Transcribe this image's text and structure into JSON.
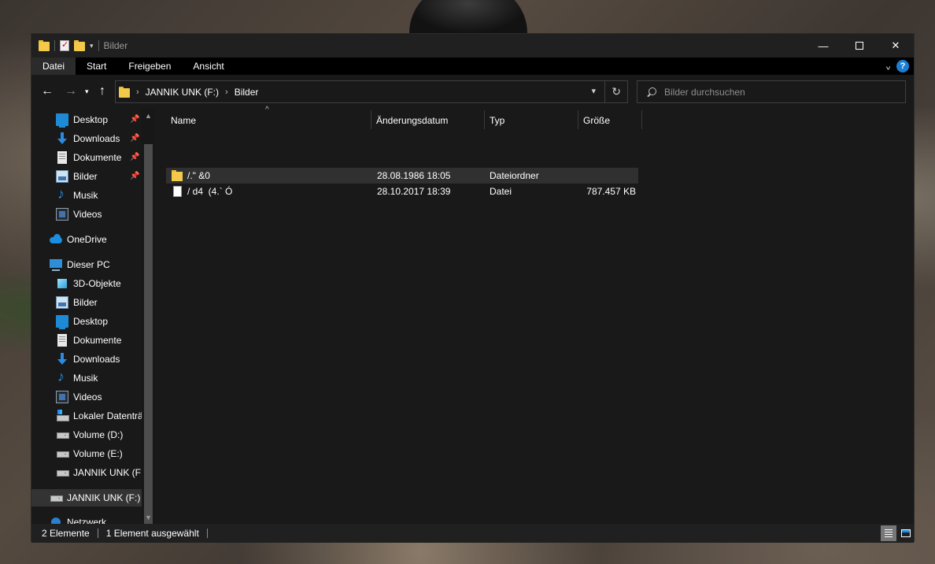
{
  "window": {
    "title": "Bilder",
    "controls": {
      "minimize": "—",
      "maximize": "",
      "close": "✕"
    }
  },
  "ribbon": {
    "tabs": [
      "Datei",
      "Start",
      "Freigeben",
      "Ansicht"
    ],
    "active_tab": "Datei"
  },
  "address": {
    "crumbs": [
      "JANNIK UNK (F:)",
      "Bilder"
    ]
  },
  "search": {
    "placeholder": "Bilder durchsuchen"
  },
  "sidebar": {
    "quick_access": [
      {
        "label": "Desktop",
        "icon": "desktop-icon",
        "pinned": true
      },
      {
        "label": "Downloads",
        "icon": "downloads-icon",
        "pinned": true
      },
      {
        "label": "Dokumente",
        "icon": "documents-icon",
        "pinned": true
      },
      {
        "label": "Bilder",
        "icon": "pictures-icon",
        "pinned": true
      },
      {
        "label": "Musik",
        "icon": "music-icon",
        "pinned": false
      },
      {
        "label": "Videos",
        "icon": "videos-icon",
        "pinned": false
      }
    ],
    "onedrive": "OneDrive",
    "this_pc": "Dieser PC",
    "pc_items": [
      {
        "label": "3D-Objekte",
        "icon": "3d-objects-icon"
      },
      {
        "label": "Bilder",
        "icon": "pictures-icon"
      },
      {
        "label": "Desktop",
        "icon": "desktop-icon"
      },
      {
        "label": "Dokumente",
        "icon": "documents-icon"
      },
      {
        "label": "Downloads",
        "icon": "downloads-icon"
      },
      {
        "label": "Musik",
        "icon": "music-icon"
      },
      {
        "label": "Videos",
        "icon": "videos-icon"
      },
      {
        "label": "Lokaler Datenträger (C:)",
        "icon": "system-drive-icon"
      },
      {
        "label": "Volume (D:)",
        "icon": "drive-icon"
      },
      {
        "label": "Volume (E:)",
        "icon": "drive-icon"
      },
      {
        "label": "JANNIK UNK (F:)",
        "icon": "drive-icon"
      }
    ],
    "selected_drive": "JANNIK UNK (F:)",
    "network": "Netzwerk"
  },
  "columns": {
    "name": "Name",
    "date": "Änderungsdatum",
    "type": "Typ",
    "size": "Größe"
  },
  "files": [
    {
      "name": "/.\" &0",
      "date": "28.08.1986 18:05",
      "type": "Dateiordner",
      "size": "",
      "icon": "folder-icon",
      "selected": true
    },
    {
      "name": "/ d4  (4.` Ó",
      "date": "28.10.2017 18:39",
      "type": "Datei",
      "size": "787.457 KB",
      "icon": "file-icon",
      "selected": false
    }
  ],
  "status": {
    "count": "2 Elemente",
    "selection": "1 Element ausgewählt"
  },
  "colors": {
    "window_bg": "#191919",
    "titlebar_bg": "#202020",
    "accent": "#1a7fd4",
    "folder": "#f3c94a"
  }
}
